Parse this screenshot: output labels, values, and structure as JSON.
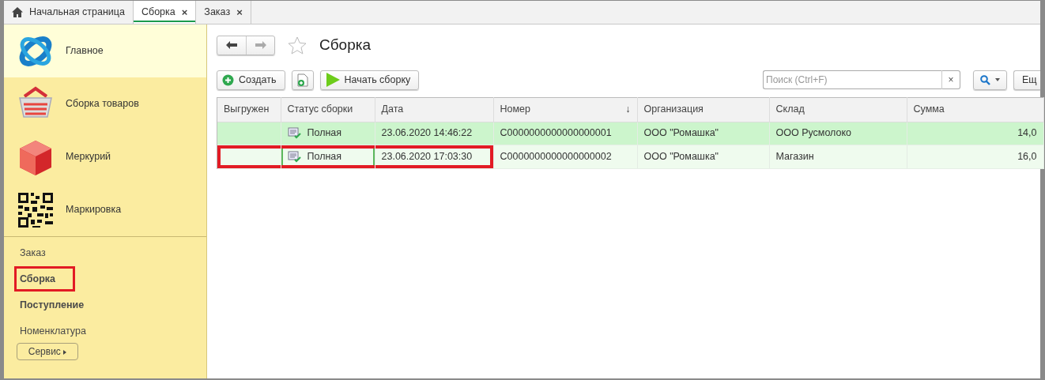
{
  "tabs": [
    {
      "label": "Начальная страница",
      "kind": "home",
      "selected": false
    },
    {
      "label": "Сборка",
      "kind": "closable",
      "selected": true
    },
    {
      "label": "Заказ",
      "kind": "closable",
      "selected": false
    }
  ],
  "close_glyph": "×",
  "sidebar": {
    "sections": [
      {
        "label": "Главное",
        "selected": true
      },
      {
        "label": "Сборка товаров",
        "selected": false
      },
      {
        "label": "Меркурий",
        "selected": false
      },
      {
        "label": "Маркировка",
        "selected": false
      }
    ],
    "links": [
      {
        "label": "Заказ",
        "bold": false,
        "highlighted": false
      },
      {
        "label": "Сборка",
        "bold": true,
        "highlighted": true
      },
      {
        "label": "Поступление",
        "bold": true,
        "highlighted": false
      },
      {
        "label": "Номенклатура",
        "bold": false,
        "highlighted": false
      }
    ],
    "service_button": "Сервис"
  },
  "page": {
    "title": "Сборка",
    "favorite": false
  },
  "toolbar": {
    "create_button": "Создать",
    "start_button": "Начать сборку",
    "search": {
      "placeholder": "Поиск (Ctrl+F)"
    },
    "clear_glyph": "×",
    "more_button": "Ещ"
  },
  "table": {
    "columns": [
      {
        "label": "Выгружен",
        "sorted": false
      },
      {
        "label": "Статус сборки",
        "sorted": false
      },
      {
        "label": "Дата",
        "sorted": false
      },
      {
        "label": "Номер",
        "sorted": true
      },
      {
        "label": "Организация",
        "sorted": false
      },
      {
        "label": "Склад",
        "sorted": false
      },
      {
        "label": "Сумма",
        "sorted": false
      }
    ],
    "sort_glyph": "↓",
    "rows": [
      {
        "selected": true,
        "highlighted": false,
        "focused": false,
        "cells": [
          "",
          "Полная",
          "23.06.2020 14:46:22",
          "С0000000000000000001",
          "ООО \"Ромашка\"",
          "ООО Русмолоко",
          "14,0"
        ]
      },
      {
        "selected": false,
        "highlighted": true,
        "focused": true,
        "cells": [
          "",
          "Полная",
          "23.06.2020 17:03:30",
          "С0000000000000000002",
          "ООО \"Ромашка\"",
          "Магазин",
          "16,0"
        ]
      }
    ]
  }
}
